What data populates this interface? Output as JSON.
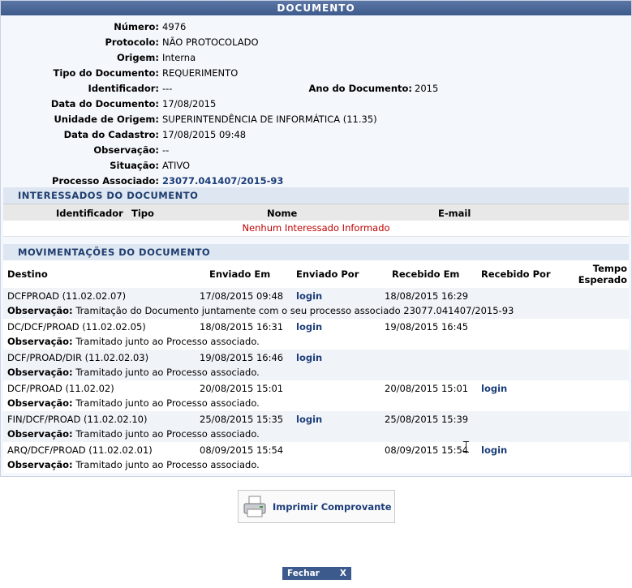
{
  "title": "DOCUMENTO",
  "fields": {
    "numero": {
      "label": "Número:",
      "value": "4976"
    },
    "protocolo": {
      "label": "Protocolo:",
      "value": "NÃO PROTOCOLADO"
    },
    "origem": {
      "label": "Origem:",
      "value": "Interna"
    },
    "tipo": {
      "label": "Tipo do Documento:",
      "value": "REQUERIMENTO"
    },
    "identificador": {
      "label": "Identificador:",
      "value": "---"
    },
    "ano": {
      "label": "Ano do Documento:",
      "value": "2015"
    },
    "data_doc": {
      "label": "Data do Documento:",
      "value": "17/08/2015"
    },
    "unidade": {
      "label": "Unidade de Origem:",
      "value": "SUPERINTENDÊNCIA DE INFORMÁTICA (11.35)"
    },
    "data_cadastro": {
      "label": "Data do Cadastro:",
      "value": "17/08/2015 09:48"
    },
    "observacao": {
      "label": "Observação:",
      "value": "--"
    },
    "situacao": {
      "label": "Situação:",
      "value": "ATIVO"
    },
    "processo": {
      "label": "Processo Associado:",
      "value": "23077.041407/2015-93"
    }
  },
  "interessados": {
    "caption": "INTERESSADOS DO DOCUMENTO",
    "headers": {
      "identificador": "Identificador",
      "tipo": "Tipo",
      "nome": "Nome",
      "email": "E-mail"
    },
    "empty": "Nenhum Interessado Informado"
  },
  "movimentacoes": {
    "caption": "MOVIMENTAÇÕES DO DOCUMENTO",
    "headers": {
      "destino": "Destino",
      "enviado_em": "Enviado Em",
      "enviado_por": "Enviado Por",
      "recebido_em": "Recebido Em",
      "recebido_por": "Recebido Por",
      "tempo1": "Tempo",
      "tempo2": "Esperado"
    },
    "obs_label": "Observação:",
    "rows": [
      {
        "destino": "DCFPROAD (11.02.02.07)",
        "enviado_em": "17/08/2015 09:48",
        "enviado_por": "login",
        "recebido_em": "18/08/2015 16:29",
        "recebido_por": "",
        "obs": "Tramitação do Documento juntamente com o seu processo associado 23077.041407/2015-93"
      },
      {
        "destino": "DC/DCF/PROAD (11.02.02.05)",
        "enviado_em": "18/08/2015 16:31",
        "enviado_por": "login",
        "recebido_em": "19/08/2015 16:45",
        "recebido_por": "",
        "obs": "Tramitado junto ao Processo associado."
      },
      {
        "destino": "DCF/PROAD/DIR (11.02.02.03)",
        "enviado_em": "19/08/2015 16:46",
        "enviado_por": "login",
        "recebido_em": "",
        "recebido_por": "",
        "obs": "Tramitado junto ao Processo associado."
      },
      {
        "destino": "DCF/PROAD (11.02.02)",
        "enviado_em": "20/08/2015 15:01",
        "enviado_por": "",
        "recebido_em": "20/08/2015 15:01",
        "recebido_por": "login",
        "obs": "Tramitado junto ao Processo associado."
      },
      {
        "destino": "FIN/DCF/PROAD (11.02.02.10)",
        "enviado_em": "25/08/2015 15:35",
        "enviado_por": "login",
        "recebido_em": "25/08/2015 15:39",
        "recebido_por": "",
        "obs": "Tramitado junto ao Processo associado."
      },
      {
        "destino": "ARQ/DCF/PROAD (11.02.02.01)",
        "enviado_em": "08/09/2015 15:54",
        "enviado_por": "",
        "recebido_em": "08/09/2015 15:54",
        "recebido_por": "login",
        "obs": "Tramitado junto ao Processo associado."
      }
    ]
  },
  "buttons": {
    "print": "Imprimir Comprovante",
    "close": "Fechar",
    "close_x": "X"
  },
  "icons": {
    "print": "printer-icon",
    "cursor": "text-cursor-icon"
  }
}
